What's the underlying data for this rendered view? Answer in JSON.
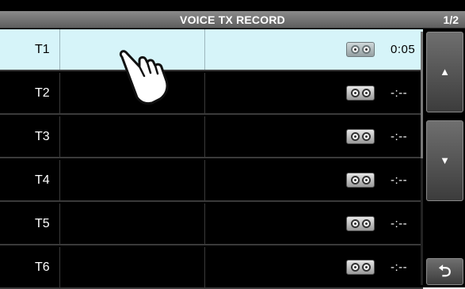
{
  "header": {
    "title": "VOICE TX RECORD",
    "page_indicator": "1/2"
  },
  "records": [
    {
      "label": "T1",
      "duration": "0:05",
      "selected": true
    },
    {
      "label": "T2",
      "duration": "-:--",
      "selected": false
    },
    {
      "label": "T3",
      "duration": "-:--",
      "selected": false
    },
    {
      "label": "T4",
      "duration": "-:--",
      "selected": false
    },
    {
      "label": "T5",
      "duration": "-:--",
      "selected": false
    },
    {
      "label": "T6",
      "duration": "-:--",
      "selected": false
    }
  ],
  "sidebar": {
    "up_glyph": "▲",
    "down_glyph": "▼",
    "back_glyph": "⮌"
  },
  "icons": {
    "record_icon": "tape-cassette-icon",
    "pointer": "pointing-hand-icon",
    "scroll_up": "triangle-up-icon",
    "scroll_down": "triangle-down-icon",
    "back": "return-arrow-icon"
  },
  "colors": {
    "selected_row": "#d6f4f9",
    "background": "#000000",
    "titlebar": "#6e6e6e"
  }
}
